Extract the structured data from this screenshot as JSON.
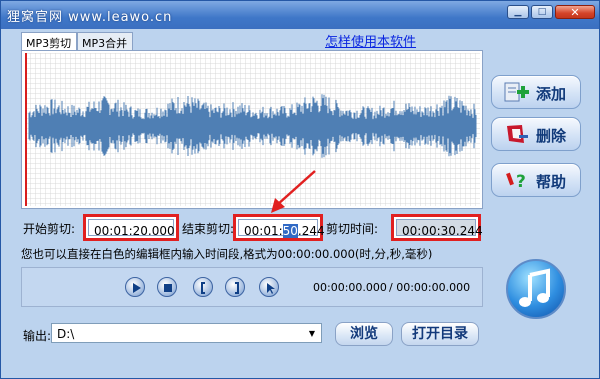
{
  "window": {
    "title": "狸窝官网 www.leawo.cn",
    "min_symbol": "▁",
    "max_symbol": "□",
    "close_symbol": "✕"
  },
  "tabs": [
    {
      "label": "MP3剪切"
    },
    {
      "label": "MP3合并"
    }
  ],
  "help_link": "怎样使用本软件",
  "side_buttons": {
    "add": "添加",
    "delete": "删除",
    "help": "帮助"
  },
  "cut": {
    "start_label": "开始剪切:",
    "start_value": "00:01:20.000",
    "end_label": "结束剪切:",
    "end_value_pre": "00:01:",
    "end_value_sel": "50",
    "end_value_post": ".244",
    "duration_label": "剪切时间:",
    "duration_value": "00:00:30.244",
    "hint": "您也可以直接在白色的编辑框内输入时间段,格式为00:00:00.000(时,分,秒,毫秒)"
  },
  "player": {
    "current": "00:00:00.000",
    "total": "/ 00:00:00.000"
  },
  "output": {
    "label": "输出:",
    "path": "D:\\",
    "browse": "浏览",
    "open_dir": "打开目录"
  },
  "colors": {
    "waveform": "#4f7fb4",
    "highlight": "#e12020",
    "title_bar": "#3f77c8"
  }
}
